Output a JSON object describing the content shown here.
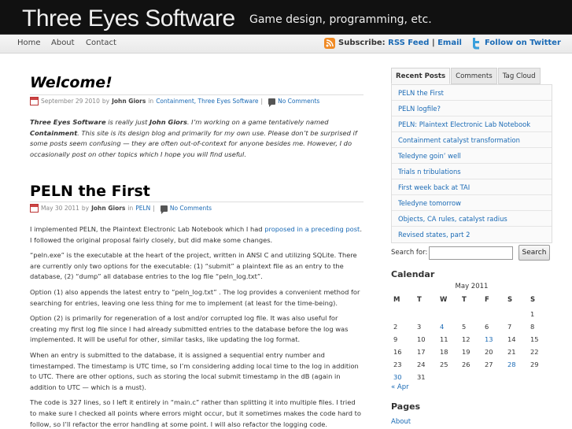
{
  "header": {
    "title": "Three Eyes Software",
    "tagline": "Game design, programming, etc."
  },
  "nav": {
    "links": [
      "Home",
      "About",
      "Contact"
    ],
    "subscribe_label": "Subscribe:",
    "rss_label": "RSS Feed",
    "separator": "|",
    "email_label": "Email",
    "twitter_label": "Follow on Twitter"
  },
  "posts": [
    {
      "title": "Welcome!",
      "date": "September 29 2010",
      "by": "by",
      "author": "John Giors",
      "in": "in",
      "categories": "Containment, Three Eyes Software",
      "sep": "|",
      "comments": "No Comments"
    },
    {
      "title": "PELN the First",
      "date": "May 30 2011",
      "by": "by",
      "author": "John Giors",
      "in": "in",
      "categories": "PELN",
      "sep": "|",
      "comments": "No Comments"
    }
  ],
  "welcome_body": {
    "b1": "Three Eyes Software",
    "t1": " is really just ",
    "b2": "John Giors",
    "t2": ". I’m working on a game tentatively named ",
    "b3": "Containment",
    "t3": ". This site is its design blog and primarily for my own use. Please don’t be surprised if some posts seem confusing — they are often out-of-context for anyone besides me. However, I do occasionally post on other topics which I hope you will find useful."
  },
  "peln_body": {
    "p1a": "I implemented PELN, the Plaintext Electronic Lab Notebook which I had ",
    "p1link": "proposed in a preceding post",
    "p1b": ". I followed the original proposal fairly closely, but did make some changes.",
    "p2": "“peln.exe” is the executable at the heart of the project, written in ANSI C and utilizing SQLite. There are currently only two options for the executable: (1) “submit” a plaintext file as an entry to the database, (2) “dump” all database entries to the log file “peln_log.txt”.",
    "p3": "Option (1) also appends the latest entry to “peln_log.txt” . The log provides a convenient method for searching for entries, leaving one less thing for me to implement (at least for the time-being).",
    "p4": "Option (2) is primarily for regeneration of a lost and/or corrupted log file. It was also useful for creating my first log file since I had already submitted entries to the database before the log was implemented. It will be useful for other, similar tasks, like updating the log format.",
    "p5": "When an entry is submitted to the database, it is assigned a sequential entry number and timestamped. The timestamp is UTC time, so I’m considering adding local time to the log in addition to UTC. There are other options, such as storing the local submit timestamp in the dB (again in addition to UTC — which is a must).",
    "p6": "The code is 327 lines, so I left it entirely in “main.c” rather than splitting it into multiple files. I tried to make sure I checked all points where errors might occur, but it sometimes makes the code hard to follow, so I’ll refactor the error handling at some point. I will also refactor the logging code."
  },
  "sidebar": {
    "tabs": [
      "Recent Posts",
      "Comments",
      "Tag Cloud"
    ],
    "recent_posts": [
      "PELN the First",
      "PELN logfile?",
      "PELN: Plaintext Electronic Lab Notebook",
      "Containment catalyst transformation",
      "Teledyne goin’ well",
      "Trials n tribulations",
      "First week back at TAI",
      "Teledyne tomorrow",
      "Objects, CA rules, catalyst radius",
      "Revised states, part 2"
    ],
    "search_label": "Search for:",
    "search_value": "",
    "search_button": "Search",
    "calendar_title": "Calendar",
    "calendar_caption": "May 2011",
    "weekdays": [
      "M",
      "T",
      "W",
      "T",
      "F",
      "S",
      "S"
    ],
    "weeks": [
      [
        "",
        "",
        "",
        "",
        "",
        "",
        "1"
      ],
      [
        "2",
        "3",
        "4",
        "5",
        "6",
        "7",
        "8"
      ],
      [
        "9",
        "10",
        "11",
        "12",
        "13",
        "14",
        "15"
      ],
      [
        "16",
        "17",
        "18",
        "19",
        "20",
        "21",
        "22"
      ],
      [
        "23",
        "24",
        "25",
        "26",
        "27",
        "28",
        "29"
      ],
      [
        "30",
        "31",
        "",
        "",
        "",
        "",
        ""
      ]
    ],
    "linked_days": [
      "4",
      "13",
      "28",
      "30"
    ],
    "prev_month": "« Apr",
    "pages_title": "Pages",
    "pages": [
      "About"
    ]
  },
  "colors": {
    "link": "#1a6ab5",
    "header_bg": "#111111",
    "rss": "#f08a24"
  }
}
